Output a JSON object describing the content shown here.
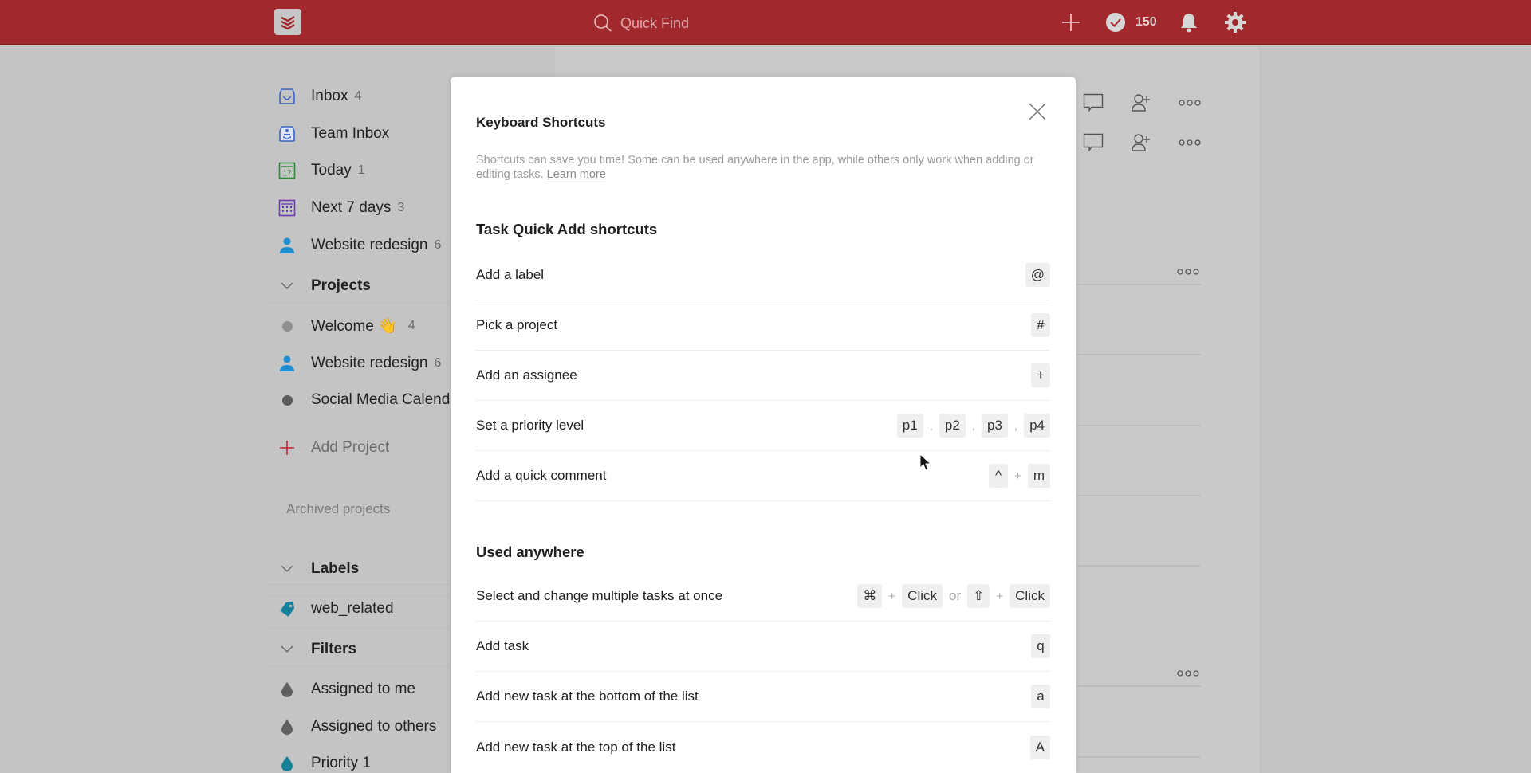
{
  "topbar": {
    "logo_icon": "todoist-logo-icon",
    "search_placeholder": "Quick Find",
    "add_icon": "plus-icon",
    "karma_icon": "check-circle-icon",
    "karma_count": "150",
    "notifications_icon": "bell-icon",
    "settings_icon": "gear-icon"
  },
  "sidebar": {
    "nav": [
      {
        "label": "Inbox",
        "count": "4",
        "icon": "inbox-icon"
      },
      {
        "label": "Team Inbox",
        "count": "",
        "icon": "team-inbox-icon"
      },
      {
        "label": "Today",
        "count": "1",
        "icon": "calendar-today-icon"
      },
      {
        "label": "Next 7 days",
        "count": "3",
        "icon": "calendar-week-icon"
      },
      {
        "label": "Website redesign",
        "count": "6",
        "icon": "person-icon"
      }
    ],
    "projects_heading": "Projects",
    "projects": [
      {
        "label": "Welcome 👋",
        "count": "4",
        "color": "#8f8f8f"
      },
      {
        "label": "Website redesign",
        "count": "6",
        "color": "#1f8ed1"
      },
      {
        "label": "Social Media Calendar",
        "count": "",
        "color": "#5a5a5a"
      }
    ],
    "add_project": "Add Project",
    "archived_projects": "Archived projects",
    "labels_heading": "Labels",
    "labels": [
      {
        "label": "web_related",
        "color": "#16809a"
      }
    ],
    "filters_heading": "Filters",
    "filters": [
      {
        "label": "Assigned to me",
        "color": "#5f5f5f"
      },
      {
        "label": "Assigned to others",
        "color": "#5f5f5f"
      },
      {
        "label": "Priority 1",
        "color": "#16809a"
      }
    ]
  },
  "modal": {
    "title": "Keyboard Shortcuts",
    "intro": "Shortcuts can save you time! Some can be used anywhere in the app, while others only work when adding or editing tasks.",
    "learn_more": "Learn more",
    "sections": [
      {
        "title": "Task Quick Add shortcuts",
        "rows": [
          {
            "desc": "Add a label",
            "keys": [
              "@"
            ]
          },
          {
            "desc": "Pick a project",
            "keys": [
              "#"
            ]
          },
          {
            "desc": "Add an assignee",
            "keys": [
              "+"
            ]
          },
          {
            "desc": "Set a priority level",
            "keys": [
              "p1",
              ",",
              "p2",
              ",",
              "p3",
              ",",
              "p4"
            ]
          },
          {
            "desc": "Add a quick comment",
            "keys": [
              "^",
              "+",
              "m"
            ]
          }
        ]
      },
      {
        "title": "Used anywhere",
        "rows": [
          {
            "desc": "Select and change multiple tasks at once",
            "keys": [
              "⌘",
              "+",
              "Click",
              "or",
              "⇧",
              "+",
              "Click"
            ]
          },
          {
            "desc": "Add task",
            "keys": [
              "q"
            ]
          },
          {
            "desc": "Add new task at the bottom of the list",
            "keys": [
              "a"
            ]
          },
          {
            "desc": "Add new task at the top of the list",
            "keys": [
              "A"
            ]
          }
        ]
      }
    ]
  },
  "colors": {
    "brand_red": "#a1282d",
    "inbox_blue": "#3b63c4",
    "today_green": "#2f8a3b",
    "week_purple": "#6c3db0",
    "person_blue": "#1f8ed1"
  }
}
